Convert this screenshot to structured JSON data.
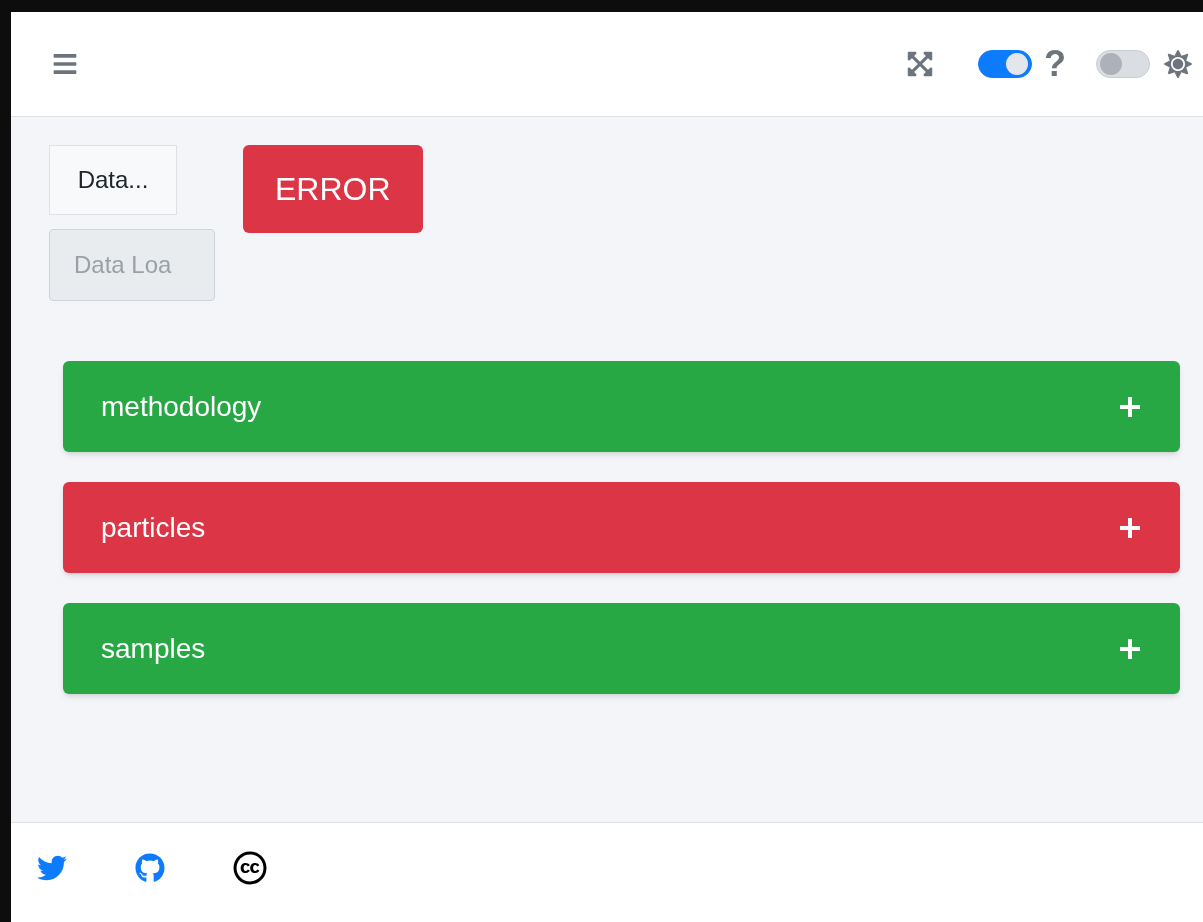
{
  "header": {
    "toggles": [
      {
        "on": true
      },
      {
        "on": false
      }
    ],
    "help_label": "?"
  },
  "controls": {
    "button": "Data...",
    "field_value": "Data Loa",
    "field_disabled": true,
    "error_badge": "ERROR"
  },
  "accordion": [
    {
      "title": "methodology",
      "color": "#28a745",
      "expanded": false
    },
    {
      "title": "particles",
      "color": "#dc3545",
      "expanded": false
    },
    {
      "title": "samples",
      "color": "#28a745",
      "expanded": false
    }
  ]
}
